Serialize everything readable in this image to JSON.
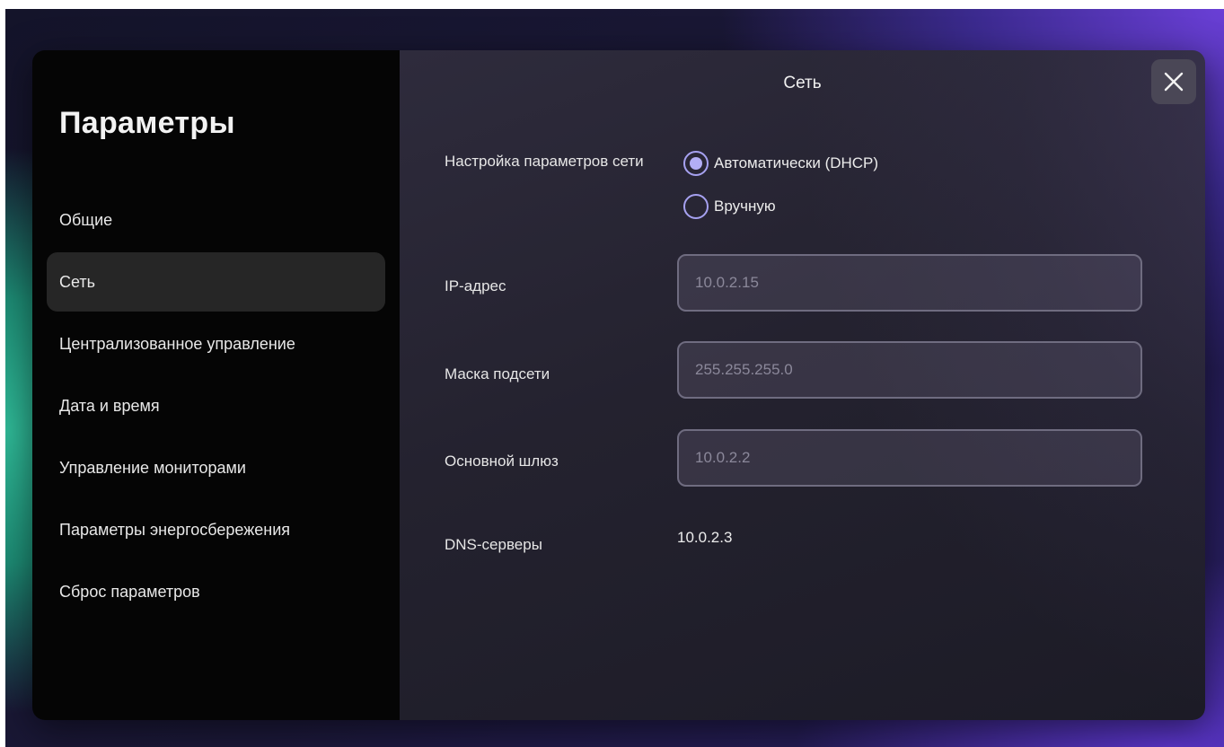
{
  "sidebar": {
    "title": "Параметры",
    "items": [
      {
        "label": "Общие",
        "active": false
      },
      {
        "label": "Сеть",
        "active": true
      },
      {
        "label": "Централизованное управление",
        "active": false
      },
      {
        "label": "Дата и время",
        "active": false
      },
      {
        "label": "Управление мониторами",
        "active": false
      },
      {
        "label": "Параметры энергосбережения",
        "active": false
      },
      {
        "label": "Сброс параметров",
        "active": false
      }
    ]
  },
  "content": {
    "title": "Сеть",
    "close_icon": "close-icon",
    "network_setup": {
      "label": "Настройка параметров сети",
      "options": [
        {
          "label": "Автоматически (DHCP)",
          "selected": true
        },
        {
          "label": "Вручную",
          "selected": false
        }
      ]
    },
    "ip_address": {
      "label": "IP-адрес",
      "value": "10.0.2.15"
    },
    "subnet_mask": {
      "label": "Маска подсети",
      "value": "255.255.255.0"
    },
    "gateway": {
      "label": "Основной шлюз",
      "value": "10.0.2.2"
    },
    "dns": {
      "label": "DNS-серверы",
      "value": "10.0.2.3"
    }
  },
  "colors": {
    "accent": "#a6a1f0",
    "sidebar_bg": "#050505",
    "active_item_bg": "#262626"
  }
}
